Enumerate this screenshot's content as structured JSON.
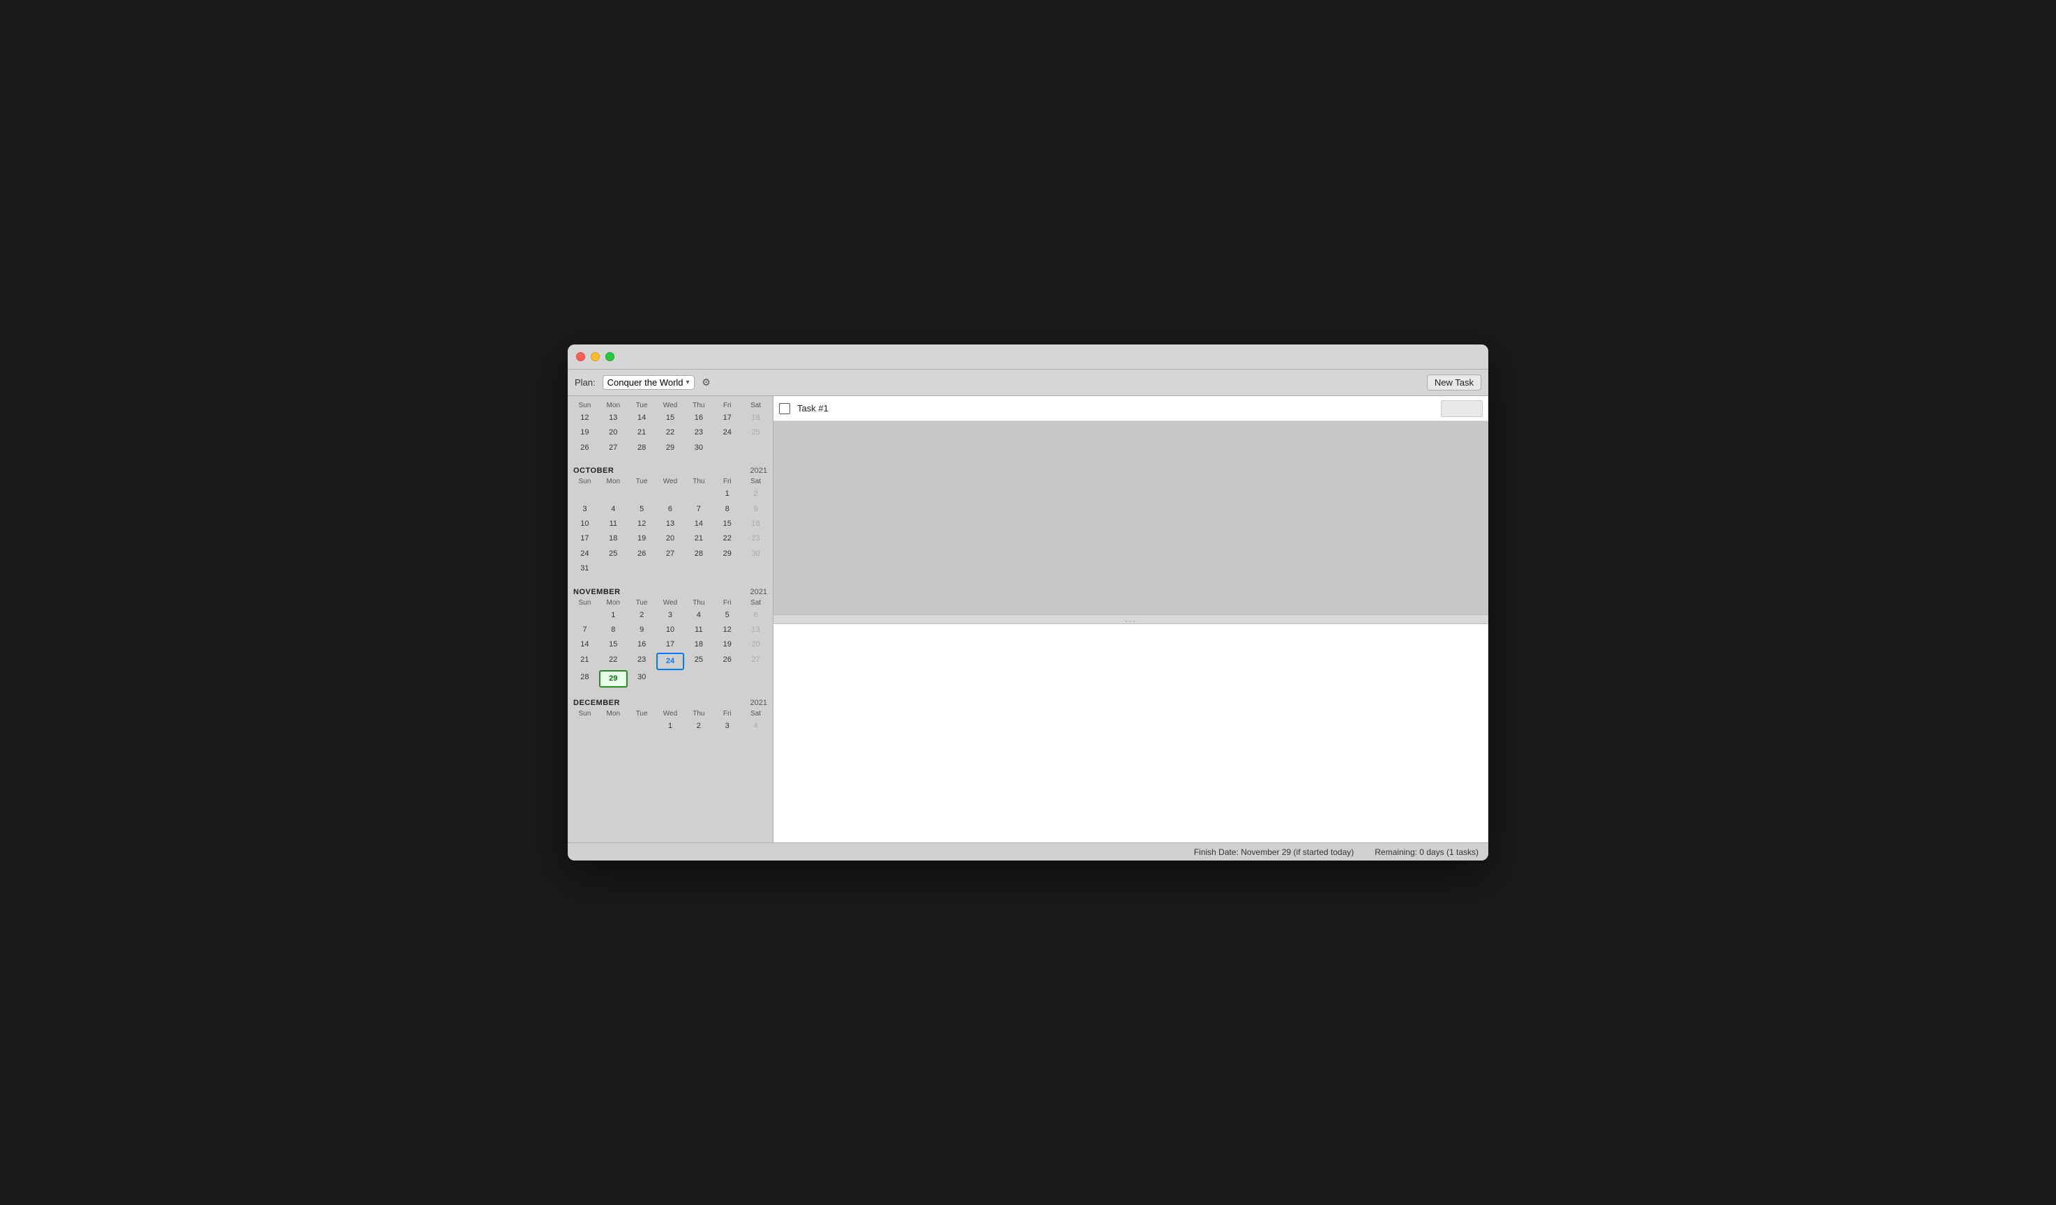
{
  "window": {
    "title": "Conquer the World"
  },
  "toolbar": {
    "plan_label": "Plan:",
    "plan_name": "Conquer the World",
    "new_task_button": "New Task",
    "gear_icon": "⚙"
  },
  "calendar": {
    "months": [
      {
        "name": "OCTOBER",
        "year": "2021",
        "days_header": [
          "Sun",
          "Mon",
          "Tue",
          "Wed",
          "Thu",
          "Fri",
          "Sat"
        ],
        "weeks": [
          [
            null,
            null,
            null,
            null,
            null,
            1,
            2
          ],
          [
            3,
            4,
            5,
            6,
            7,
            8,
            9
          ],
          [
            10,
            11,
            12,
            13,
            14,
            15,
            16
          ],
          [
            17,
            18,
            19,
            20,
            21,
            22,
            23
          ],
          [
            24,
            25,
            26,
            27,
            28,
            29,
            30
          ],
          [
            31,
            null,
            null,
            null,
            null,
            null,
            null
          ]
        ]
      },
      {
        "name": "NOVEMBER",
        "year": "2021",
        "days_header": [
          "Sun",
          "Mon",
          "Tue",
          "Wed",
          "Thu",
          "Fri",
          "Sat"
        ],
        "weeks": [
          [
            null,
            1,
            2,
            3,
            4,
            5,
            6
          ],
          [
            7,
            8,
            9,
            10,
            11,
            12,
            13
          ],
          [
            14,
            15,
            16,
            17,
            18,
            19,
            20
          ],
          [
            21,
            22,
            23,
            24,
            25,
            26,
            27
          ],
          [
            28,
            29,
            30,
            null,
            null,
            null,
            null
          ]
        ],
        "today": 24,
        "selected": 29
      },
      {
        "name": "DECEMBER",
        "year": "2021",
        "days_header": [
          "Sun",
          "Mon",
          "Tue",
          "Wed",
          "Thu",
          "Fri",
          "Sat"
        ],
        "weeks": [
          [
            null,
            null,
            null,
            1,
            2,
            3,
            4
          ]
        ]
      }
    ],
    "prev_weeks": [
      {
        "row": [
          12,
          13,
          14,
          15,
          16,
          17,
          18
        ]
      },
      {
        "row": [
          19,
          20,
          21,
          22,
          23,
          24,
          25
        ]
      },
      {
        "row": [
          26,
          27,
          28,
          29,
          30,
          null,
          null
        ]
      }
    ]
  },
  "tasks": [
    {
      "id": 1,
      "name": "Task #1",
      "checked": false,
      "date": ""
    }
  ],
  "resize_handle": "...",
  "status_bar": {
    "finish_date": "Finish Date: November 29 (if started today)",
    "remaining": "Remaining: 0 days (1 tasks)"
  }
}
